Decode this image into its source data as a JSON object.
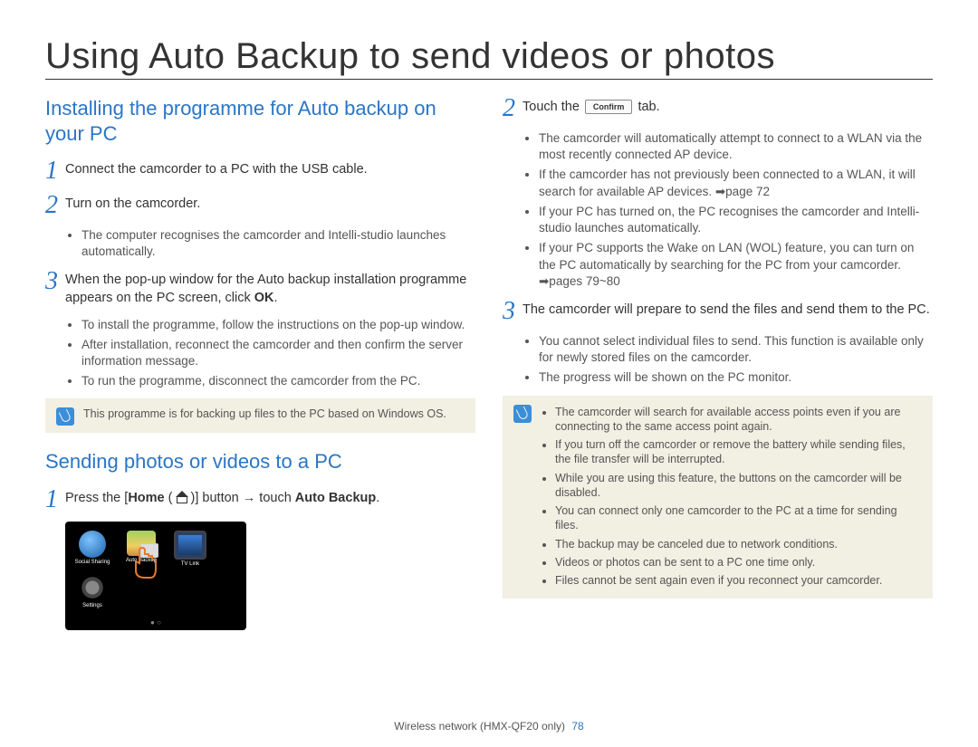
{
  "title": "Using Auto Backup to send videos or photos",
  "section1": {
    "heading": "Installing the programme for Auto backup on your PC",
    "steps": [
      {
        "n": "1",
        "text": "Connect the camcorder to a PC with the USB cable.",
        "sub": []
      },
      {
        "n": "2",
        "text": "Turn on the camcorder.",
        "sub": [
          "The computer recognises the camcorder and Intelli-studio launches automatically."
        ]
      },
      {
        "n": "3",
        "text_pre": "When the pop-up window for the Auto backup installation programme appears on the PC screen, click ",
        "text_bold": "OK",
        "text_post": ".",
        "sub": [
          "To install the programme, follow the instructions on the pop-up window.",
          "After installation, reconnect the camcorder and then confirm the server information message.",
          "To run the programme, disconnect the camcorder from the PC."
        ]
      }
    ],
    "note": "This programme is for backing up files to the PC based on Windows OS."
  },
  "section2": {
    "heading": "Sending photos or videos to a PC",
    "step1_pre": "Press the [",
    "step1_home": "Home",
    "step1_mid": " ( ",
    "step1_post": " )] button → touch ",
    "step1_bold": "Auto Backup",
    "step1_end": ".",
    "sc_labels": {
      "a": "Social Sharing",
      "b": "Auto Backup",
      "c": "TV Link",
      "d": "Settings"
    }
  },
  "section3": {
    "step2_pre": "Touch the ",
    "step2_btn": "Confirm",
    "step2_post": " tab.",
    "step2_sub": [
      "The camcorder will automatically attempt to connect to a WLAN via the most recently connected AP device.",
      "If the camcorder has not previously been connected to a WLAN, it will search for available AP devices. ➡page 72",
      "If your PC has turned on, the PC recognises the camcorder and Intelli-studio launches automatically.",
      "If your PC supports the Wake on LAN (WOL) feature, you can turn on the PC automatically by searching for the PC from your camcorder. ➡pages 79~80"
    ],
    "step3_text": "The camcorder will prepare to send the files and send them to the PC.",
    "step3_sub": [
      "You cannot select individual files to send. This function is available only for newly stored files on the camcorder.",
      "The progress will be shown on the PC monitor."
    ],
    "note_items": [
      "The camcorder will search for available access points even if you are connecting to the same access point again.",
      "If you turn off the camcorder or remove the battery while sending files, the file transfer will be interrupted.",
      "While you are using this feature, the buttons on the camcorder will be disabled.",
      "You can connect only one camcorder to the PC at a time for sending files.",
      "The backup may be canceled due to network conditions.",
      "Videos or photos can be sent to a PC one time only.",
      "Files cannot be sent again even if you reconnect your camcorder."
    ]
  },
  "footer": {
    "text": "Wireless network (HMX-QF20 only)",
    "page": "78"
  }
}
